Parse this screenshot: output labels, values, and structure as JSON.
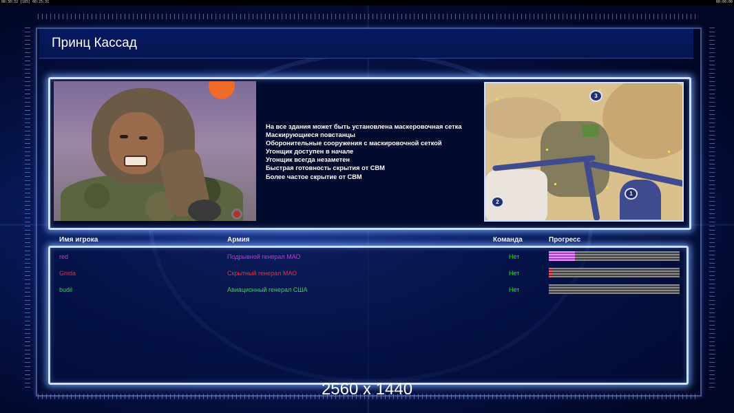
{
  "hud": {
    "clock_left": "08:30:32 [165] 00:25:31",
    "clock_right": "00:00:00"
  },
  "header": {
    "title": "Принц Кассад"
  },
  "info": {
    "features": [
      "На все здания может быть установлена маскеровочная сетка",
      "Маскирующиеся повстанцы",
      "Оборонительные сооружения с маскировочной сеткой",
      "Угонщик доступен в начале",
      "Угонщик всегда незаметен",
      "Быстрая готовность скрытия от СВМ",
      "Более частое скрытие от СВМ"
    ],
    "map_spawns": [
      "3",
      "2",
      "1"
    ]
  },
  "table": {
    "headers": {
      "player": "Имя игрока",
      "army": "Армия",
      "team": "Команда",
      "progress": "Прогресс"
    },
    "rows": [
      {
        "name": "red",
        "army": "Подрывной генерал МАО",
        "team": "Нет",
        "color": "#c03ad6",
        "progress": 0.2
      },
      {
        "name": "Gnida",
        "army": "Скрытный генерал МАО",
        "team": "Нет",
        "color": "#ff2a2a",
        "progress": 0.02
      },
      {
        "name": "budil",
        "army": "Авиационный генерал США",
        "team": "Нет",
        "color": "#33dd33",
        "progress": 0
      }
    ]
  },
  "footer": {
    "resolution": "2560 x 1440"
  },
  "colors": {
    "panel_border": "#cfe0ff",
    "background": "#000722",
    "team_text": "#33dd33"
  }
}
